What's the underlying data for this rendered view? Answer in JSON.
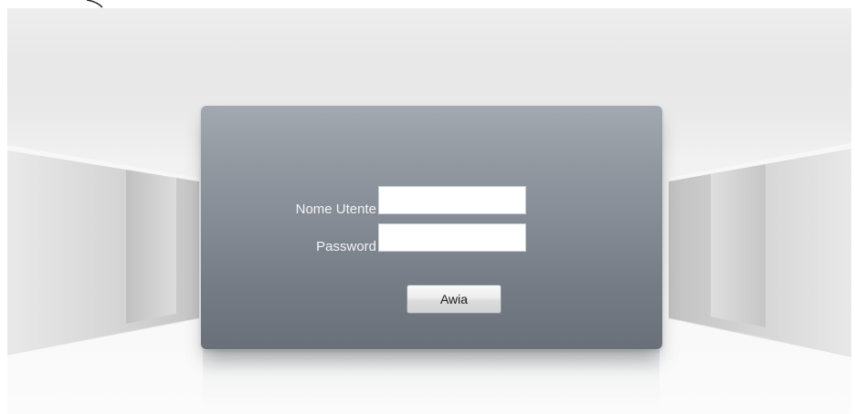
{
  "login_form": {
    "username_label": "Nome Utente",
    "username_value": "",
    "password_label": "Password",
    "password_value": "",
    "submit_label": "Awia"
  },
  "colors": {
    "panel_top": "#a3a9b1",
    "panel_bottom": "#6a7079",
    "label_text": "#f3f4f6",
    "background": "#f4f4f4"
  }
}
